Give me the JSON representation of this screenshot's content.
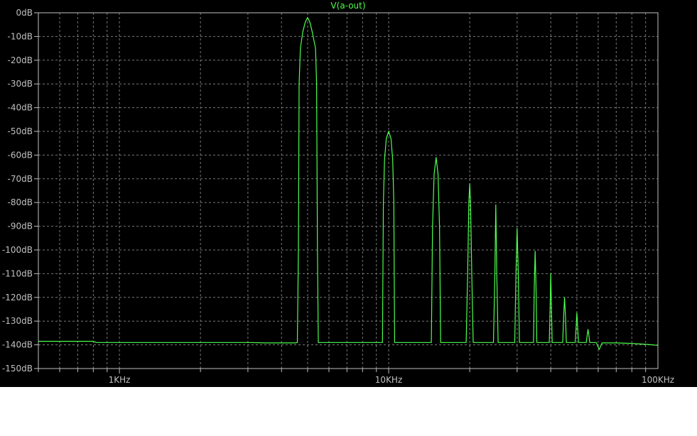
{
  "chart_data": {
    "type": "line",
    "title": "V(a-out)",
    "xlabel": "",
    "ylabel": "",
    "x_scale": "log",
    "xlim": [
      500,
      100000
    ],
    "ylim": [
      -150,
      0
    ],
    "grid": true,
    "colors": {
      "background": "#000000",
      "grid": "#7a7a7a",
      "axis": "#c0c0c0",
      "trace": "#4cff4c"
    },
    "x_tick_labels": [
      {
        "value": 1000,
        "label": "1KHz"
      },
      {
        "value": 10000,
        "label": "10KHz"
      },
      {
        "value": 100000,
        "label": "100KHz"
      }
    ],
    "y_tick_labels": [
      {
        "value": 0,
        "label": "0dB"
      },
      {
        "value": -10,
        "label": "-10dB"
      },
      {
        "value": -20,
        "label": "-20dB"
      },
      {
        "value": -30,
        "label": "-30dB"
      },
      {
        "value": -40,
        "label": "-40dB"
      },
      {
        "value": -50,
        "label": "-50dB"
      },
      {
        "value": -60,
        "label": "-60dB"
      },
      {
        "value": -70,
        "label": "-70dB"
      },
      {
        "value": -80,
        "label": "-80dB"
      },
      {
        "value": -90,
        "label": "-90dB"
      },
      {
        "value": -100,
        "label": "-100dB"
      },
      {
        "value": -110,
        "label": "-110dB"
      },
      {
        "value": -120,
        "label": "-120dB"
      },
      {
        "value": -130,
        "label": "-130dB"
      },
      {
        "value": -140,
        "label": "-140dB"
      },
      {
        "value": -150,
        "label": "-150dB"
      }
    ],
    "series": [
      {
        "name": "V(a-out)",
        "points": [
          [
            500,
            -138.5
          ],
          [
            800,
            -138.5
          ],
          [
            820,
            -139.0
          ],
          [
            2000,
            -139.0
          ],
          [
            3000,
            -139.0
          ],
          [
            3500,
            -139.2
          ],
          [
            4500,
            -139.2
          ],
          [
            4580,
            -139.0
          ],
          [
            4620,
            -100
          ],
          [
            4650,
            -30
          ],
          [
            4700,
            -15
          ],
          [
            4800,
            -8
          ],
          [
            4900,
            -4
          ],
          [
            5000,
            -2
          ],
          [
            5100,
            -4
          ],
          [
            5200,
            -8
          ],
          [
            5350,
            -15
          ],
          [
            5400,
            -30
          ],
          [
            5440,
            -100
          ],
          [
            5480,
            -139.0
          ],
          [
            9300,
            -139.0
          ],
          [
            9480,
            -139.0
          ],
          [
            9560,
            -80
          ],
          [
            9650,
            -62
          ],
          [
            9800,
            -53
          ],
          [
            10000,
            -50
          ],
          [
            10200,
            -53
          ],
          [
            10350,
            -62
          ],
          [
            10450,
            -80
          ],
          [
            10520,
            -139.0
          ],
          [
            14000,
            -139.0
          ],
          [
            14400,
            -139.0
          ],
          [
            14550,
            -90
          ],
          [
            14750,
            -68
          ],
          [
            15000,
            -61
          ],
          [
            15250,
            -68
          ],
          [
            15450,
            -90
          ],
          [
            15600,
            -139.0
          ],
          [
            19400,
            -139.0
          ],
          [
            19650,
            -110
          ],
          [
            19850,
            -80
          ],
          [
            20000,
            -72
          ],
          [
            20150,
            -80
          ],
          [
            20350,
            -110
          ],
          [
            20600,
            -139.0
          ],
          [
            24500,
            -139.0
          ],
          [
            24800,
            -110
          ],
          [
            25000,
            -81
          ],
          [
            25200,
            -110
          ],
          [
            25500,
            -139.0
          ],
          [
            29400,
            -139.0
          ],
          [
            29700,
            -110
          ],
          [
            30000,
            -91
          ],
          [
            30300,
            -110
          ],
          [
            30600,
            -139.0
          ],
          [
            34500,
            -139.0
          ],
          [
            34750,
            -115
          ],
          [
            35000,
            -100.5
          ],
          [
            35250,
            -115
          ],
          [
            35500,
            -139.0
          ],
          [
            39500,
            -139.0
          ],
          [
            39750,
            -125
          ],
          [
            40000,
            -110
          ],
          [
            40250,
            -125
          ],
          [
            40500,
            -139.0
          ],
          [
            44300,
            -139.0
          ],
          [
            44650,
            -128
          ],
          [
            45000,
            -120
          ],
          [
            45350,
            -128
          ],
          [
            45700,
            -139.0
          ],
          [
            49300,
            -139.0
          ],
          [
            49650,
            -133
          ],
          [
            50000,
            -126.5
          ],
          [
            50350,
            -133
          ],
          [
            50700,
            -139.0
          ],
          [
            54200,
            -139.0
          ],
          [
            54600,
            -136
          ],
          [
            55000,
            -133.5
          ],
          [
            55400,
            -136
          ],
          [
            55800,
            -139.0
          ],
          [
            59000,
            -139.0
          ],
          [
            60500,
            -142
          ],
          [
            62000,
            -139.2
          ],
          [
            70000,
            -139.2
          ],
          [
            80000,
            -139.4
          ],
          [
            90000,
            -139.8
          ],
          [
            100000,
            -140.2
          ]
        ]
      }
    ]
  }
}
